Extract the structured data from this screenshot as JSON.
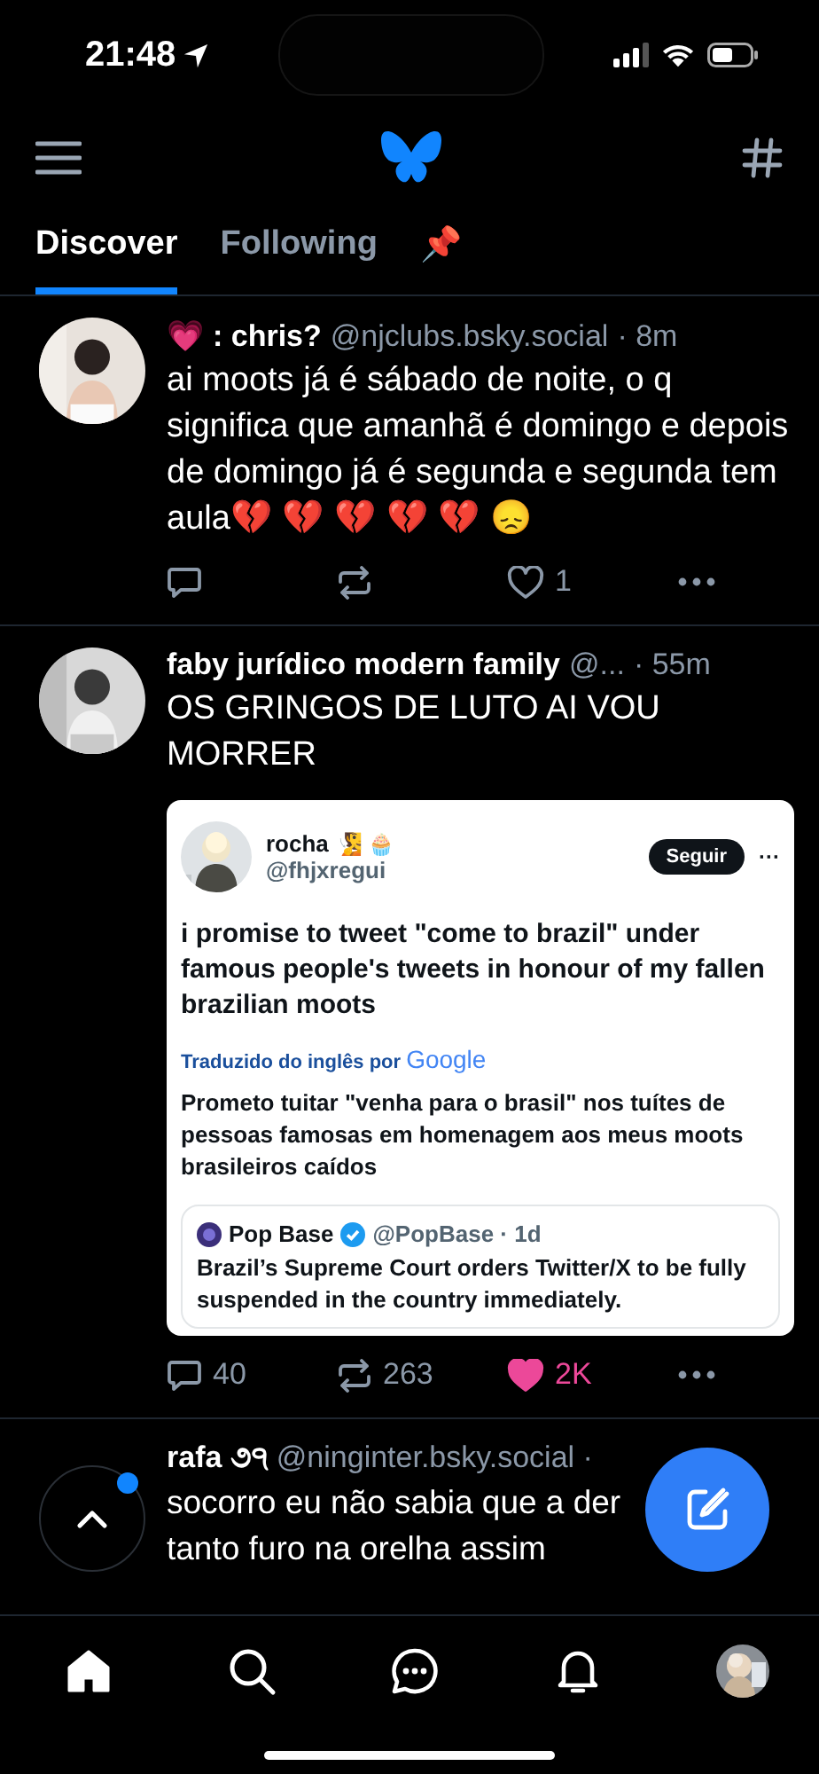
{
  "status_bar": {
    "time": "21:48"
  },
  "tabs": [
    {
      "label": "Discover",
      "selected": true
    },
    {
      "label": "Following",
      "selected": false
    },
    {
      "label": "📌",
      "selected": false
    }
  ],
  "posts": [
    {
      "emoji": "💗",
      "name": ": chris?",
      "handle": "@njclubs.bsky.social",
      "time": "· 8m",
      "text": "ai moots já é sábado de noite, o q significa que amanhã é domingo e depois de domingo já é segunda e segunda tem aula💔 💔 💔 💔 💔 😞",
      "likes": "1",
      "liked": false
    },
    {
      "name": "faby jurídico modern family",
      "handle": "@...",
      "time": "· 55m",
      "text": "OS GRINGOS DE LUTO AI VOU MORRER",
      "replies": "40",
      "reposts": "263",
      "likes": "2K",
      "liked": true,
      "embed": {
        "name": "rocha",
        "name_emoji": "🧏 🧁",
        "handle": "@fhjxregui",
        "follow_button": "Seguir",
        "more": "···",
        "text": "i promise to tweet \"come to brazil\" under famous people's tweets in honour of my fallen brazilian moots",
        "translated_by": "Traduzido do inglês por",
        "translator": "Google",
        "translation": "Prometo tuitar \"venha para o brasil\" nos tuítes de pessoas famosas em homenagem aos meus moots brasileiros caídos",
        "quote": {
          "name": "Pop Base",
          "handle": "@PopBase · 1d",
          "text": "Brazil’s Supreme Court orders Twitter/X to be fully suspended in the country immediately."
        }
      }
    },
    {
      "name": "rafa ૭੧",
      "handle": "@ninginter.bsky.social ·",
      "text": "socorro eu não sabia que a der\ntanto furo na orelha assim"
    }
  ]
}
